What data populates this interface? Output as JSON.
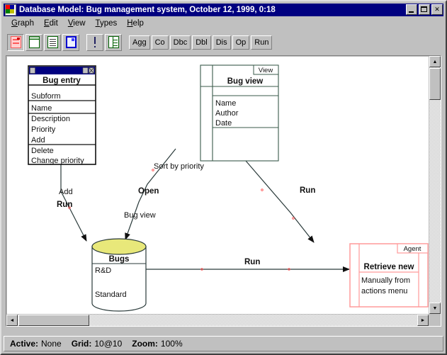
{
  "window": {
    "title": "Database Model: Bug management system, October 12, 1999, 0:18",
    "icon": "app-icon",
    "minimize_label": "_",
    "maximize_label": "□",
    "close_label": "✕"
  },
  "menu": {
    "items": [
      {
        "label": "Graph",
        "accel": "G"
      },
      {
        "label": "Edit",
        "accel": "E"
      },
      {
        "label": "View",
        "accel": "V"
      },
      {
        "label": "Types",
        "accel": "T"
      },
      {
        "label": "Help",
        "accel": "H"
      }
    ]
  },
  "toolbar": {
    "icon_buttons": [
      {
        "name": "new-form-icon",
        "style": "red",
        "pressed": true
      },
      {
        "name": "new-document-icon",
        "style": "grn",
        "pressed": false
      },
      {
        "name": "list-view-icon",
        "style": "lines",
        "pressed": false
      },
      {
        "name": "selected-document-icon",
        "style": "blue",
        "pressed": false
      },
      {
        "name": "run-exclamation-icon",
        "style": "bang",
        "pressed": false
      },
      {
        "name": "split-view-icon",
        "style": "split",
        "pressed": false
      }
    ],
    "text_buttons": [
      {
        "label": "Agg",
        "name": "aggregate-button"
      },
      {
        "label": "Co",
        "name": "connection-button"
      },
      {
        "label": "Dbc",
        "name": "dbc-button"
      },
      {
        "label": "Dbl",
        "name": "dbl-button"
      },
      {
        "label": "Dis",
        "name": "dis-button"
      },
      {
        "label": "Op",
        "name": "operation-button"
      },
      {
        "label": "Run",
        "name": "run-button"
      }
    ]
  },
  "diagram": {
    "nodes": {
      "bug_entry": {
        "title": "Bug entry",
        "sections": [
          [
            "Subform"
          ],
          [
            "Name",
            "Description",
            "Priority"
          ],
          [
            "Add",
            "Delete",
            "Change priority"
          ]
        ]
      },
      "bug_view": {
        "stereotype": "View",
        "title": "Bug view",
        "attributes": [
          "Name",
          "Author",
          "Date"
        ]
      },
      "bugs": {
        "title": "Bugs",
        "rows": [
          "R&D",
          "Standard"
        ],
        "top_color": "#e8e87a"
      },
      "retrieve_new": {
        "stereotype": "Agent",
        "title": "Retrieve new",
        "lines": [
          "Manually from",
          "actions menu"
        ],
        "color": "#ff9a9a"
      }
    },
    "edges": [
      {
        "name": "edge-bugentry-bugs-add",
        "label": "Add",
        "bold": false
      },
      {
        "name": "edge-bugentry-bugs-run",
        "label": "Run",
        "bold": true
      },
      {
        "name": "edge-bugview-sort",
        "label": "Sort by priority",
        "bold": false
      },
      {
        "name": "edge-bugview-open",
        "label": "Open",
        "bold": true
      },
      {
        "name": "edge-bugview-bugs",
        "label": "Bug view",
        "bold": false
      },
      {
        "name": "edge-bugview-agent-run",
        "label": "Run",
        "bold": true
      },
      {
        "name": "edge-bugs-agent-run",
        "label": "Run",
        "bold": true
      }
    ]
  },
  "scrollbars": {
    "up_arrow": "▲",
    "down_arrow": "▼",
    "left_arrow": "◄",
    "right_arrow": "►"
  },
  "status": {
    "active_label": "Active:",
    "active_value": "None",
    "grid_label": "Grid:",
    "grid_value": "10@10",
    "zoom_label": "Zoom:",
    "zoom_value": "100%"
  }
}
